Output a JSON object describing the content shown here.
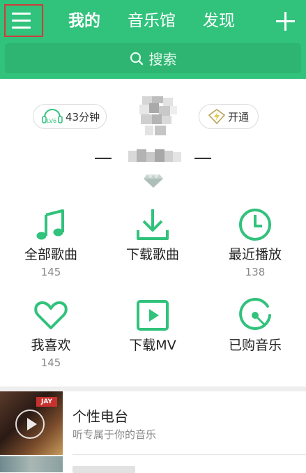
{
  "header": {
    "tabs": [
      {
        "label": "我的",
        "active": true
      },
      {
        "label": "音乐馆",
        "active": false
      },
      {
        "label": "发现",
        "active": false
      }
    ],
    "menu_icon": "hamburger-menu-icon",
    "add_icon": "plus-icon",
    "accent_color": "#31c27c"
  },
  "search": {
    "placeholder": "搜索",
    "icon": "search-icon"
  },
  "profile": {
    "listen_time": "43分钟",
    "listen_badge": "LV6",
    "vip_label": "开通"
  },
  "quick_actions": [
    {
      "label": "全部歌曲",
      "count": "145",
      "icon": "music-note-icon"
    },
    {
      "label": "下载歌曲",
      "count": "",
      "icon": "download-icon"
    },
    {
      "label": "最近播放",
      "count": "138",
      "icon": "clock-icon"
    },
    {
      "label": "我喜欢",
      "count": "145",
      "icon": "heart-icon"
    },
    {
      "label": "下载MV",
      "count": "",
      "icon": "play-video-icon"
    },
    {
      "label": "已购音乐",
      "count": "",
      "icon": "vinyl-disc-icon"
    }
  ],
  "radio": {
    "title": "个性电台",
    "subtitle": "听专属于你的音乐",
    "thumb_tag": "JAY"
  }
}
